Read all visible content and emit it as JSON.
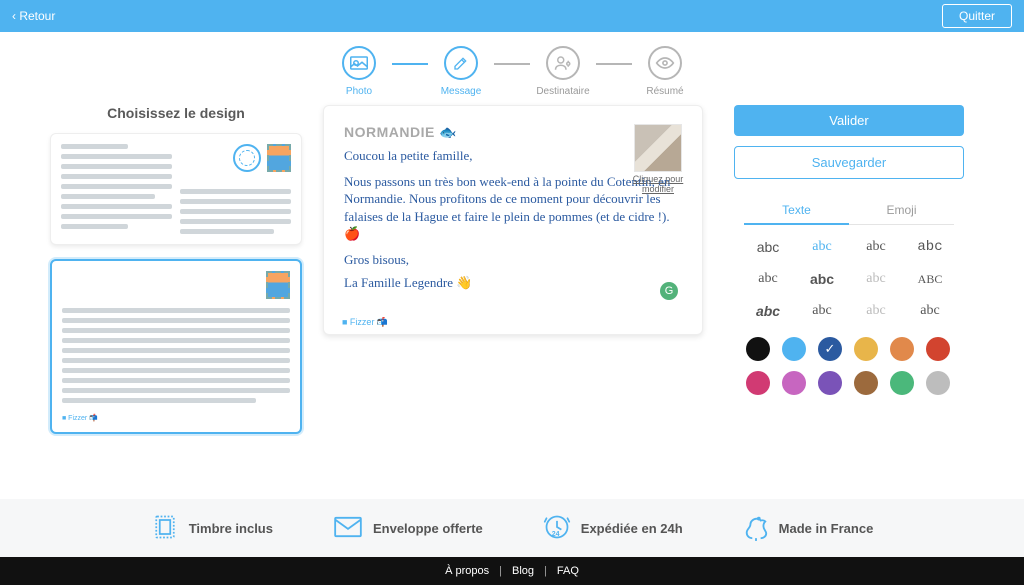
{
  "topbar": {
    "back": "‹ Retour",
    "quit": "Quitter"
  },
  "steps": [
    {
      "key": "photo",
      "label": "Photo",
      "active": true
    },
    {
      "key": "message",
      "label": "Message",
      "active": true
    },
    {
      "key": "dest",
      "label": "Destinataire",
      "active": false
    },
    {
      "key": "resume",
      "label": "Résumé",
      "active": false
    }
  ],
  "left": {
    "title": "Choisissez le design"
  },
  "postcard": {
    "title": "NORMANDIE",
    "title_emoji": "🐟",
    "lines": [
      "Coucou la petite famille,",
      "Nous passons un très bon week-end à la pointe du Cotentin, en Normandie. Nous profitons de ce moment pour découvrir les falaises de la Hague et faire le plein de pommes (et de cidre !). 🍎",
      "Gros bisous,",
      "La Famille Legendre 👋"
    ],
    "photo_caption": "Cliquez pour modifier",
    "footer_brand": "■ Fizzer 📬"
  },
  "right": {
    "validate": "Valider",
    "save": "Sauvegarder",
    "tab_text": "Texte",
    "tab_emoji": "Emoji",
    "fonts": [
      {
        "t": "abc",
        "style": "font-family:Arial"
      },
      {
        "t": "abc",
        "style": "font-family:'Brush Script MT',cursive;color:#4fb3f0",
        "sel": true
      },
      {
        "t": "abc",
        "style": "font-family:Georgia"
      },
      {
        "t": "abc",
        "style": "font-family:'Courier New'"
      },
      {
        "t": "abc",
        "style": "font-family:'Trebuchet MS'"
      },
      {
        "t": "abc",
        "style": "font-family:Arial;font-weight:700"
      },
      {
        "t": "abc",
        "style": "font-family:Verdana;color:#bbb"
      },
      {
        "t": "ABC",
        "style": "font-family:Impact;font-size:12px"
      },
      {
        "t": "abc",
        "style": "font-style:italic;font-weight:700"
      },
      {
        "t": "abc",
        "style": "font-family:'Segoe Script',cursive"
      },
      {
        "t": "abc",
        "style": "font-family:serif;color:#bbb"
      },
      {
        "t": "abc",
        "style": "font-family:cursive"
      }
    ],
    "colors": [
      "#111111",
      "#4fb3f0",
      "#2b5aa0",
      "#e8b54a",
      "#e1894b",
      "#d2442f",
      "#d13a73",
      "#c766c0",
      "#7a53b8",
      "#9c6a3d",
      "#4bb87b",
      "#bdbdbd"
    ],
    "selected_color_index": 2
  },
  "features": [
    "Timbre inclus",
    "Enveloppe offerte",
    "Expédiée en 24h",
    "Made in France"
  ],
  "footer": [
    "À propos",
    "Blog",
    "FAQ"
  ]
}
